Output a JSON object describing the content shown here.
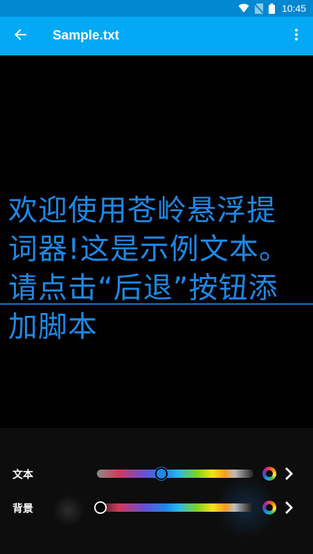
{
  "status_bar": {
    "time": "10:45",
    "icons": [
      "wifi-icon",
      "no-sim-icon",
      "battery-icon"
    ]
  },
  "app_bar": {
    "title": "Sample.txt",
    "back_icon": "arrow-back-icon",
    "menu_icon": "more-vert-icon",
    "background": "#03a9f4"
  },
  "prompter": {
    "text": "欢迎使用苍岭悬浮提词器!这是示例文本。 请点击“后退”按钮添加脚本",
    "text_color": "#1e88e5",
    "background": "#000000"
  },
  "controls": {
    "text_label": "文本",
    "background_label": "背景",
    "text_slider_value": 0.41,
    "background_slider_value": 0.02,
    "color_picker_icon": "color-wheel-icon",
    "next_icon": "chevron-right-icon"
  }
}
